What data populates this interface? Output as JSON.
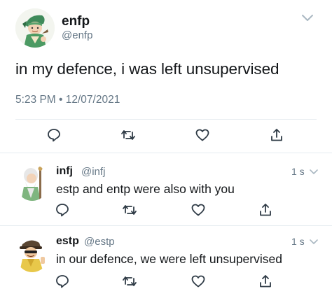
{
  "main_tweet": {
    "display_name": "enfp",
    "handle": "@enfp",
    "text": "in my defence, i was left unsupervised",
    "timestamp": "5:23 PM • 12/07/2021"
  },
  "replies": [
    {
      "display_name": "infj",
      "handle": "@infj",
      "time": "1 s",
      "text": "estp and entp were also with you"
    },
    {
      "display_name": "estp",
      "handle": "@estp",
      "time": "1 s",
      "text": "in our defence, we were left unsupervised"
    }
  ],
  "icons": {
    "reply": "reply-icon",
    "retweet": "retweet-icon",
    "like": "like-icon",
    "share": "share-icon",
    "more": "chevron-down-icon"
  },
  "colors": {
    "text": "#14171a",
    "secondary_text": "#657786",
    "divider": "#e6ecf0"
  }
}
